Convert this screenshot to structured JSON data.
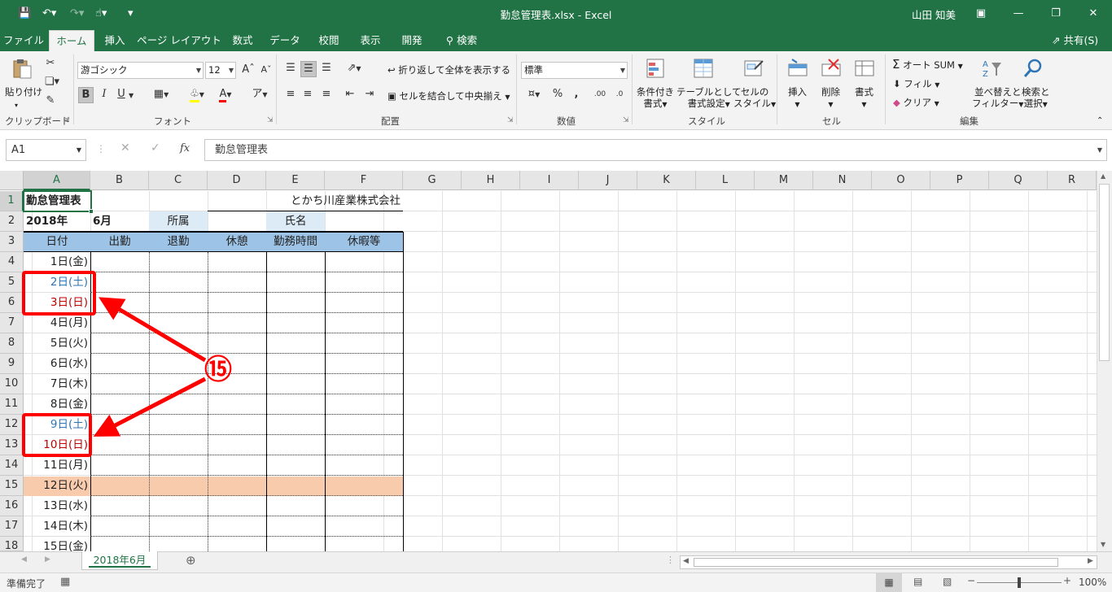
{
  "window": {
    "title": "勤怠管理表.xlsx - Excel",
    "user": "山田 知美"
  },
  "menu": {
    "tabs": [
      "ファイル",
      "ホーム",
      "挿入",
      "ページ レイアウト",
      "数式",
      "データ",
      "校閲",
      "表示",
      "開発",
      "検索"
    ],
    "share": "共有(S)"
  },
  "ribbon": {
    "clipboard": {
      "paste": "貼り付け",
      "label": "クリップボード"
    },
    "font": {
      "name": "游ゴシック",
      "size": "12",
      "label": "フォント",
      "bold": "B",
      "italic": "I",
      "underline": "U"
    },
    "alignment": {
      "wrap": "折り返して全体を表示する",
      "merge": "セルを結合して中央揃え",
      "label": "配置"
    },
    "number": {
      "format": "標準",
      "label": "数値"
    },
    "styles": {
      "conditional": [
        "条件付き",
        "書式"
      ],
      "table": [
        "テーブルとして",
        "書式設定"
      ],
      "cell": [
        "セルの",
        "スタイル"
      ],
      "label": "スタイル"
    },
    "cells": {
      "insert": "挿入",
      "delete": "削除",
      "format": "書式",
      "label": "セル"
    },
    "editing": {
      "autosum": "オート SUM",
      "fill": "フィル",
      "clear": "クリア",
      "sort": [
        "並べ替えと",
        "フィルター"
      ],
      "find": [
        "検索と",
        "選択"
      ],
      "label": "編集"
    }
  },
  "formula_bar": {
    "name_box": "A1",
    "fx": "fx",
    "content": "勤怠管理表"
  },
  "columns": [
    "A",
    "B",
    "C",
    "D",
    "E",
    "F",
    "G",
    "H",
    "I",
    "J",
    "K",
    "L",
    "M",
    "N",
    "O",
    "P",
    "Q",
    "R"
  ],
  "rows": [
    "1",
    "2",
    "3",
    "4",
    "5",
    "6",
    "7",
    "8",
    "9",
    "10",
    "11",
    "12",
    "13",
    "14",
    "15",
    "16",
    "17",
    "18"
  ],
  "sheet": {
    "a1": "勤怠管理表",
    "company": "とかち川産業株式会社",
    "year": "2018年",
    "month": "6月",
    "affiliation": "所属",
    "name": "氏名",
    "headers": [
      "日付",
      "出勤",
      "退勤",
      "休憩",
      "勤務時間",
      "休暇等"
    ],
    "dates": [
      "1日(金)",
      "2日(土)",
      "3日(日)",
      "4日(月)",
      "5日(火)",
      "6日(水)",
      "7日(木)",
      "8日(金)",
      "9日(土)",
      "10日(日)",
      "11日(月)",
      "12日(火)",
      "13日(水)",
      "14日(木)",
      "15日(金)"
    ]
  },
  "colors": {
    "excel_green": "#217346",
    "saturday": "#2e75b6",
    "sunday": "#c00000",
    "highlight_row": "#f8cbad",
    "annotation": "#ff0000"
  },
  "annotation": {
    "label": "⑮"
  },
  "sheet_tabs": {
    "active": "2018年6月"
  },
  "status": {
    "ready": "準備完了",
    "zoom": "100%"
  }
}
